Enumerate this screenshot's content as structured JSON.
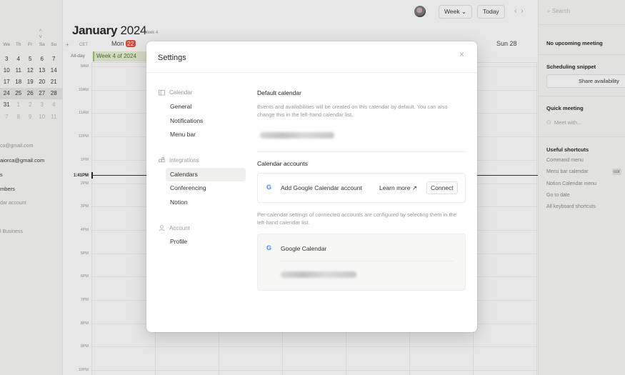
{
  "sidebar": {
    "weekday_headers": [
      "We",
      "Th",
      "Fr",
      "Sa",
      "Su"
    ],
    "month_nav": [
      "^",
      "v"
    ],
    "mini_calendar_rows": [
      {
        "days": [
          "3",
          "4",
          "5",
          "6",
          "7"
        ],
        "highlight": false,
        "dim": false
      },
      {
        "days": [
          "10",
          "11",
          "12",
          "13",
          "14"
        ],
        "highlight": false,
        "dim": false
      },
      {
        "days": [
          "17",
          "18",
          "19",
          "20",
          "21"
        ],
        "highlight": false,
        "dim": false
      },
      {
        "days": [
          "24",
          "25",
          "26",
          "27",
          "28"
        ],
        "highlight": true,
        "dim": false
      },
      {
        "days": [
          "31",
          "1",
          "2",
          "3",
          "4"
        ],
        "highlight": false,
        "dim": false
      },
      {
        "days": [
          "7",
          "8",
          "9",
          "10",
          "11"
        ],
        "highlight": false,
        "dim": true
      }
    ],
    "accounts": [
      {
        "text": "ca@gmail.com",
        "muted": true
      },
      {
        "text": "aiorca@gmail.com",
        "muted": false
      },
      {
        "text": "s",
        "muted": false
      },
      {
        "text": "mbers",
        "muted": false
      },
      {
        "text": "dar account",
        "muted": true
      },
      {
        "text": "",
        "muted": false
      },
      {
        "text": "l Business",
        "muted": true
      }
    ]
  },
  "topbar": {
    "week_label": "Week ⌄",
    "today_label": "Today",
    "prev_arrow": "‹",
    "next_arrow": "›"
  },
  "calendar": {
    "month": "January",
    "year": "2024",
    "week_tag": "Week 4",
    "timezone": "CET",
    "add_symbol": "+",
    "day_mon": "Mon",
    "day_mon_num": "22",
    "day_sun": "Sun 28",
    "allday_label": "All-day",
    "allday_event": "Week 4 of 2024",
    "now_time": "1:41PM",
    "hours": [
      "9AM",
      "10AM",
      "11AM",
      "12PM",
      "1PM",
      "2PM",
      "3PM",
      "4PM",
      "5PM",
      "6PM",
      "7PM",
      "8PM",
      "9PM",
      "10PM"
    ]
  },
  "right_panel": {
    "search_placeholder": "Search",
    "no_meetings": "No upcoming meeting",
    "scheduling_title": "Scheduling snippet",
    "share_button": "Share availability",
    "quick_title": "Quick meeting",
    "meet_placeholder": "Meet with...",
    "shortcuts_title": "Useful shortcuts",
    "shortcuts": [
      "Command menu",
      "Menu bar calendar",
      "Notion Calendar menu",
      "Go to date",
      "All keyboard shortcuts"
    ],
    "kbd_hint": "cor"
  },
  "settings": {
    "title": "Settings",
    "close": "×",
    "nav": {
      "calendar_group": "Calendar",
      "general": "General",
      "notifications": "Notifications",
      "menu_bar": "Menu bar",
      "integrations_group": "Integrations",
      "calendars": "Calendars",
      "conferencing": "Conferencing",
      "notion": "Notion",
      "account_group": "Account",
      "profile": "Profile"
    },
    "default_calendar": {
      "heading": "Default calendar",
      "description": "Events and availabilities will be created on this calendar by default. You can also change this in the left-hand calendar list."
    },
    "accounts": {
      "heading": "Calendar accounts",
      "add_google": "Add Google Calendar account",
      "learn_more": "Learn more ↗",
      "connect": "Connect",
      "per_calendar_note": "Per-calendar settings of connected accounts are configured by selecting them in the left-hand calendar list.",
      "google_calendar": "Google Calendar",
      "google_letter": "G"
    }
  }
}
